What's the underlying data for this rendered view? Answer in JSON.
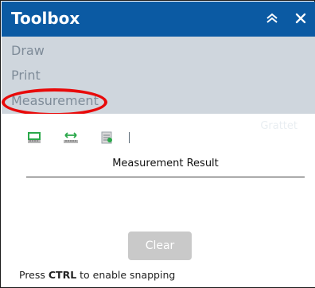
{
  "panel": {
    "title": "Toolbox",
    "icons": [
      "collapse-chevrons-icon",
      "close-icon"
    ]
  },
  "menu": {
    "items": [
      {
        "label": "Draw"
      },
      {
        "label": "Print"
      },
      {
        "label": "Measurement"
      }
    ]
  },
  "measurement": {
    "tools": [
      "measure-area-icon",
      "measure-distance-icon",
      "measure-location-icon"
    ],
    "result_label": "Measurement Result",
    "clear_label": "Clear",
    "hint_before": "Press ",
    "hint_key": "CTRL",
    "hint_after": " to enable snapping"
  },
  "map_label": "Grattet",
  "colors": {
    "header_bg": "#0b5aa3",
    "menu_bg": "#cfd6dd",
    "menu_text": "#7f8c99",
    "highlight": "#e80a0a",
    "tool_green": "#2aa84a",
    "button_disabled": "#c9c9c9"
  }
}
